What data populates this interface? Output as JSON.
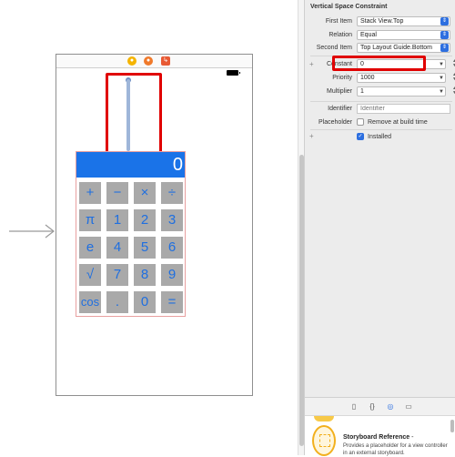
{
  "calculator": {
    "display": "0",
    "keys": [
      [
        "+",
        "−",
        "×",
        "÷"
      ],
      [
        "π",
        "1",
        "2",
        "3"
      ],
      [
        "e",
        "4",
        "5",
        "6"
      ],
      [
        "√",
        "7",
        "8",
        "9"
      ],
      [
        "cos",
        ".",
        "0",
        "="
      ]
    ]
  },
  "inspector": {
    "title": "Vertical Space Constraint",
    "rows": {
      "first_item_label": "First Item",
      "first_item_value": "Stack View.Top",
      "relation_label": "Relation",
      "relation_value": "Equal",
      "second_item_label": "Second Item",
      "second_item_value": "Top Layout Guide.Bottom",
      "constant_label": "Constant",
      "constant_value": "0",
      "priority_label": "Priority",
      "priority_value": "1000",
      "multiplier_label": "Multiplier",
      "multiplier_value": "1",
      "identifier_label": "Identifier",
      "identifier_placeholder": "Identifier",
      "placeholder_label": "Placeholder",
      "placeholder_check_label": "Remove at build time",
      "installed_label": "Installed"
    }
  },
  "library": {
    "item_title": "Storyboard Reference",
    "item_title_suffix": " -",
    "item_description": "Provides a placeholder for a view controller in an external storyboard."
  },
  "colors": {
    "accent": "#1a73e8",
    "highlight": "#e00000",
    "key_background": "#a9a9a9"
  }
}
